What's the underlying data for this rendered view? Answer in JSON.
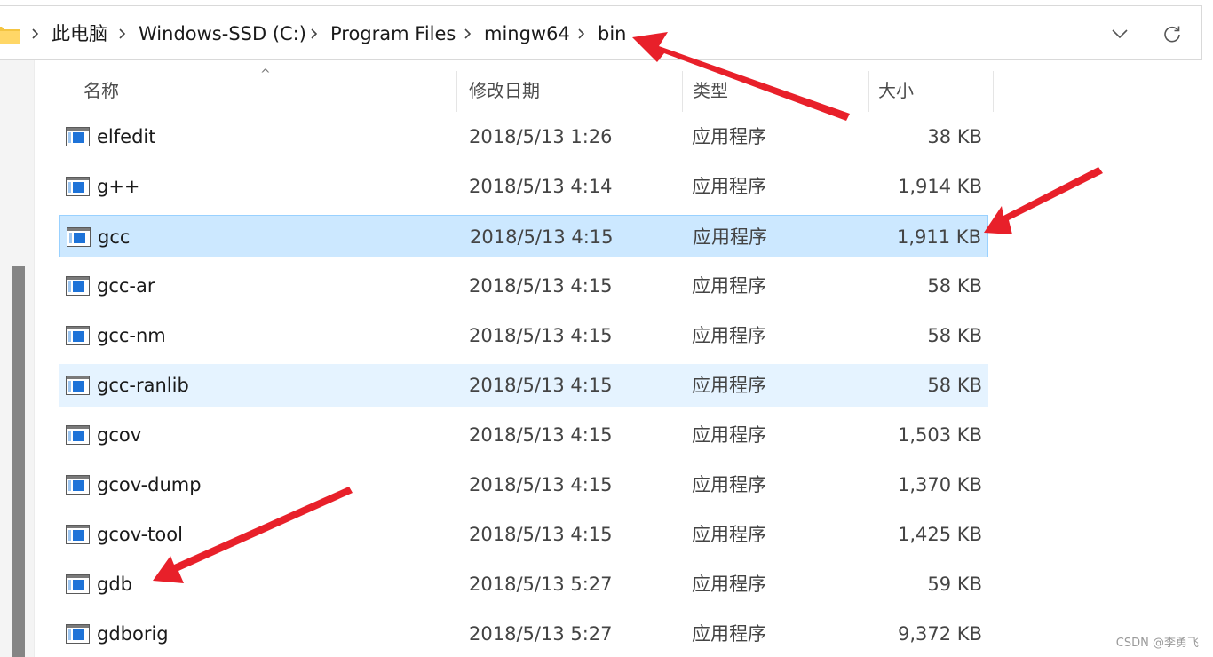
{
  "breadcrumb": {
    "items": [
      "此电脑",
      "Windows-SSD (C:)",
      "Program Files",
      "mingw64",
      "bin"
    ],
    "separator_icon": "chevron-right-icon",
    "folder_icon": "folder-icon"
  },
  "toolbar": {
    "dropdown_icon": "chevron-down-icon",
    "refresh_icon": "refresh-icon"
  },
  "columns": {
    "name": "名称",
    "date": "修改日期",
    "type": "类型",
    "size": "大小"
  },
  "files": [
    {
      "name": "elfedit",
      "date": "2018/5/13 1:26",
      "type": "应用程序",
      "size": "38 KB",
      "state": ""
    },
    {
      "name": "g++",
      "date": "2018/5/13 4:14",
      "type": "应用程序",
      "size": "1,914 KB",
      "state": ""
    },
    {
      "name": "gcc",
      "date": "2018/5/13 4:15",
      "type": "应用程序",
      "size": "1,911 KB",
      "state": "selected"
    },
    {
      "name": "gcc-ar",
      "date": "2018/5/13 4:15",
      "type": "应用程序",
      "size": "58 KB",
      "state": ""
    },
    {
      "name": "gcc-nm",
      "date": "2018/5/13 4:15",
      "type": "应用程序",
      "size": "58 KB",
      "state": ""
    },
    {
      "name": "gcc-ranlib",
      "date": "2018/5/13 4:15",
      "type": "应用程序",
      "size": "58 KB",
      "state": "hover"
    },
    {
      "name": "gcov",
      "date": "2018/5/13 4:15",
      "type": "应用程序",
      "size": "1,503 KB",
      "state": ""
    },
    {
      "name": "gcov-dump",
      "date": "2018/5/13 4:15",
      "type": "应用程序",
      "size": "1,370 KB",
      "state": ""
    },
    {
      "name": "gcov-tool",
      "date": "2018/5/13 4:15",
      "type": "应用程序",
      "size": "1,425 KB",
      "state": ""
    },
    {
      "name": "gdb",
      "date": "2018/5/13 5:27",
      "type": "应用程序",
      "size": "59 KB",
      "state": ""
    },
    {
      "name": "gdborig",
      "date": "2018/5/13 5:27",
      "type": "应用程序",
      "size": "9,372 KB",
      "state": ""
    }
  ],
  "colors": {
    "selected_bg": "#cce8ff",
    "hover_bg": "#e5f3ff",
    "annotation": "#e8202a"
  },
  "watermark": "CSDN @李勇飞"
}
